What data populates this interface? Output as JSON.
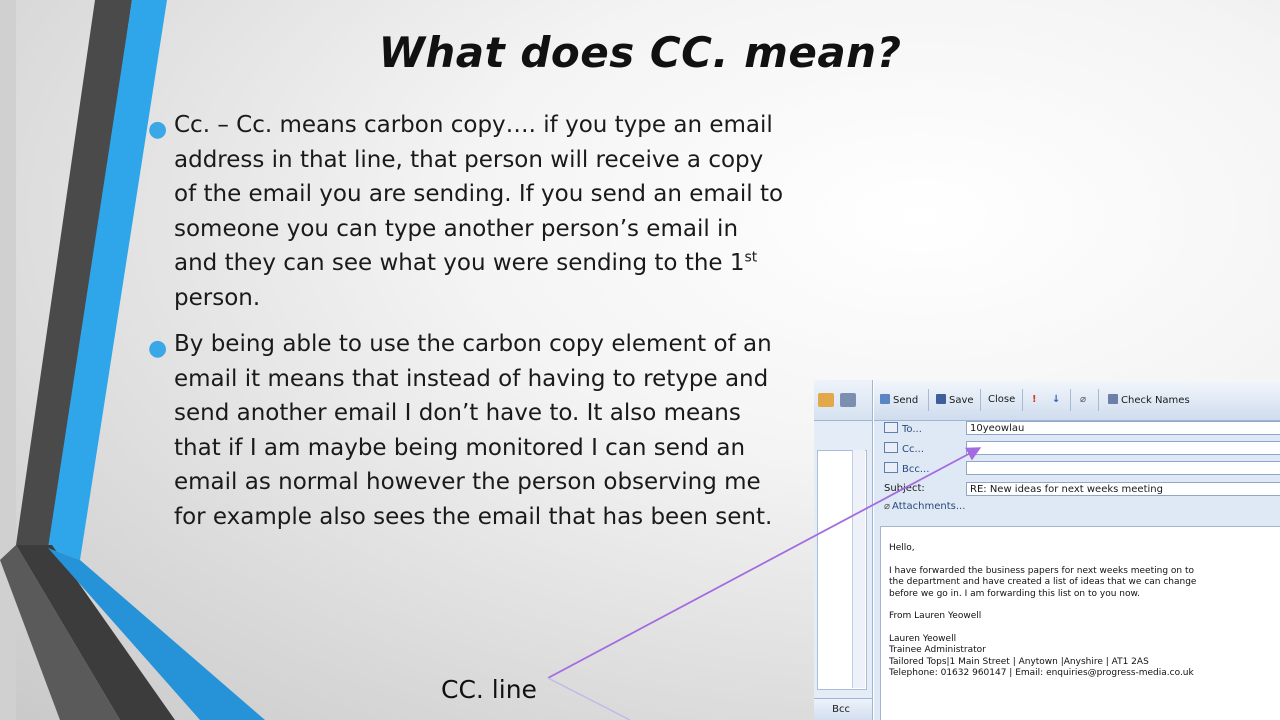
{
  "slide": {
    "title": "What does CC. mean?",
    "bullet1": {
      "text": "Cc. – Cc. means carbon copy…. if you type an email address in that line, that person will receive a copy of the email you are sending. If you send an email to someone you can type another person’s email in and they can see what you were sending to the 1",
      "superscript": "st",
      "tail": " person."
    },
    "bullet2": "By being able to use the carbon copy element of an email it means that instead of having to retype and send another email I don’t have to. It also means that if I am maybe being monitored I can send an email as normal however the person observing me for example also sees the email that has been sent.",
    "caption": "CC. line"
  },
  "colors": {
    "accent_blue": "#29a3e8",
    "dark_stripe": "#3d3d3d",
    "arrow": "#a36be0"
  },
  "outlook": {
    "toolbar": {
      "send": "Send",
      "save": "Save",
      "close": "Close",
      "check_names": "Check Names"
    },
    "header": {
      "to_label": "To...",
      "to_value": "10yeowlau",
      "cc_label": "Cc...",
      "cc_value": "",
      "bcc_label": "Bcc...",
      "bcc_value": "",
      "subject_label": "Subject:",
      "subject_value": "RE: New ideas for next weeks meeting",
      "attachments_label": "Attachments..."
    },
    "body": {
      "greeting": "Hello,",
      "line1": "I have forwarded the business papers for next weeks meeting on to",
      "line2": "the department and have created a list of ideas that we can change",
      "line3": "before we go in. I am forwarding this list on to you now.",
      "from": "From Lauren Yeowell",
      "sig_name": "Lauren Yeowell",
      "sig_title": "Trainee Administrator",
      "sig_address": "Tailored Tops|1 Main Street | Anytown |Anyshire | AT1 2AS",
      "sig_contact": "Telephone: 01632 960147 | Email: enquiries@progress-media.co.uk"
    },
    "left_pane_bottom": "Bcc"
  }
}
